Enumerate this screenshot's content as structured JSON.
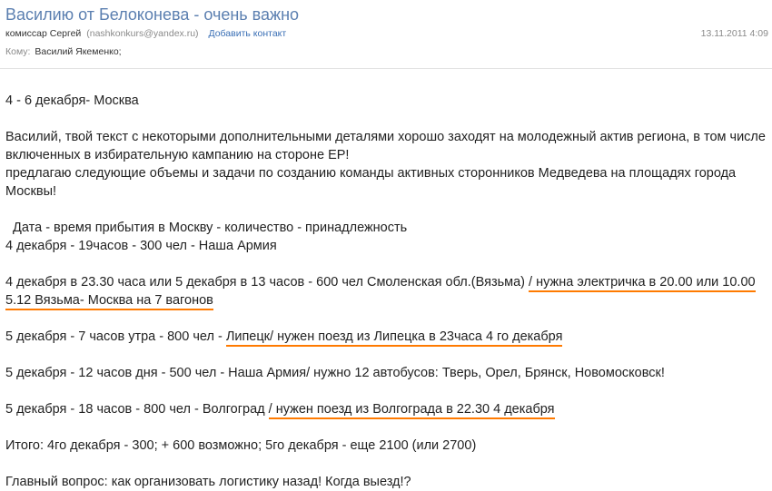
{
  "header": {
    "subject": "Василию от Белоконева - очень важно",
    "sender_name": "комиссар Сергей",
    "sender_email": "(nashkonkurs@yandex.ru)",
    "add_contact": "Добавить контакт",
    "date": "13.11.2011 4:09",
    "to_label": "Кому:",
    "to_value": "Василий Якеменко;"
  },
  "body": {
    "line1": "4 - 6 декабря- Москва",
    "p1_l1": "Василий, твой текст с некоторыми дополнительными деталями хорошо заходят на молодежный актив региона, в том числе",
    "p1_l2": "включенных в избирательную кампанию на стороне ЕР!",
    "p1_l3": "предлагаю следующие объемы и задачи по созданию команды активных сторонников Медведева на площадях города",
    "p1_l4": "Москвы!",
    "table_header": "  Дата - время прибытия в Москву - количество - принадлежность",
    "row1": "4 декабря - 19часов - 300 чел - Наша Армия",
    "row2_a": "4 декабря в 23.30 часа или 5 декабря в 13 часов - 600 чел Смоленская обл.(Вязьма) ",
    "row2_b": "/ нужна электричка в 20.00 или 10.00",
    "row2_c": "5.12 Вязьма- Москва на 7 вагонов",
    "row3_a": "5 декабря - 7 часов утра - 800 чел - ",
    "row3_b": "Липецк/ нужен поезд из Липецка в 23часа 4 го декабря",
    "row4": "5 декабря - 12 часов дня - 500 чел - Наша Армия/ нужно 12 автобусов: Тверь, Орел, Брянск, Новомосковск!",
    "row5_a": "5 декабря - 18 часов - 800 чел - Волгоград ",
    "row5_b": "/ нужен поезд из Волгограда в 22.30 4 декабря",
    "total": "Итого: 4го декабря - 300; + 600 возможно; 5го декабря - еще 2100 (или 2700)",
    "question": "Главный вопрос: как организовать логистику назад! Когда выезд!?"
  },
  "colors": {
    "subject": "#5b7fb0",
    "link": "#3a6fb5",
    "underline": "#ff7a00"
  }
}
